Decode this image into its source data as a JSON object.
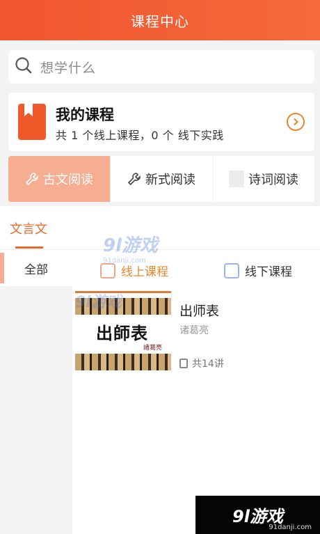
{
  "header": {
    "title": "课程中心"
  },
  "search": {
    "placeholder": "想学什么"
  },
  "my_course": {
    "title": "我的课程",
    "subtitle": "共 1 个线上课程，0 个 线下实践"
  },
  "categories": [
    {
      "label": "古文阅读",
      "active": true,
      "icon": "wrench-icon"
    },
    {
      "label": "新式阅读",
      "active": false,
      "icon": "wrench-icon"
    },
    {
      "label": "诗词阅读",
      "active": false,
      "icon": "placeholder-box"
    }
  ],
  "section_tab": {
    "label": "文言文"
  },
  "sidebar": {
    "items": [
      {
        "label": "全部",
        "active": true
      }
    ]
  },
  "type_tabs": {
    "online": {
      "label": "线上课程",
      "active": true
    },
    "offline": {
      "label": "线下课程",
      "active": false
    }
  },
  "course": {
    "thumb_title": "出師表",
    "thumb_author": "諸葛亮",
    "title": "出师表",
    "author": "诸葛亮",
    "lessons": "共14讲"
  },
  "watermark": {
    "brand": "9l游戏",
    "domain": "91danji.com"
  },
  "colors": {
    "accent": "#f1542f",
    "active_tab_bg": "#f6ad91",
    "orange_text": "#e8862b"
  }
}
